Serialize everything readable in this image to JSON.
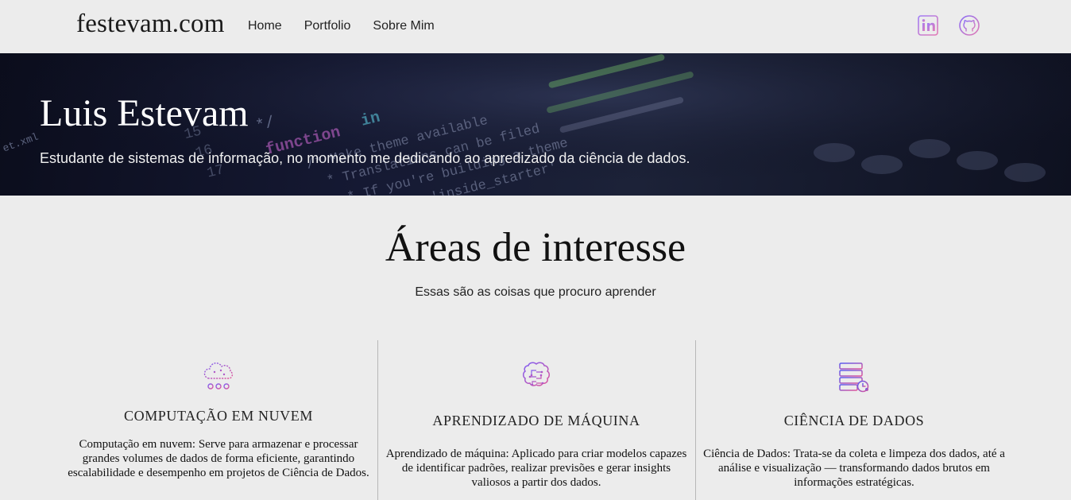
{
  "nav": {
    "brand": "festevam.com",
    "links": [
      "Home",
      "Portfolio",
      "Sobre Mim"
    ],
    "social": [
      {
        "icon": "linkedin-icon"
      },
      {
        "icon": "github-icon"
      }
    ]
  },
  "hero": {
    "name": "Luis Estevam",
    "subtitle": "Estudante de sistemas de informação, no momento me dedicando ao apredizado da ciência de dados."
  },
  "section": {
    "title": "Áreas de interesse",
    "subtitle": "Essas são as coisas que procuro aprender"
  },
  "cards": [
    {
      "icon": "cloud-computing-icon",
      "title": "COMPUTAÇÃO EM NUVEM",
      "text": "Computação em nuvem: Serve para armazenar e processar grandes volumes de dados de forma eficiente, garantindo escalabilidade e desempenho em projetos de Ciência de Dados."
    },
    {
      "icon": "brain-chip-icon",
      "title": "APRENDIZADO DE MÁQUINA",
      "text": "Aprendizado de máquina: Aplicado para criar modelos capazes de identificar padrões, realizar previsões e gerar insights valiosos a partir dos dados."
    },
    {
      "icon": "database-server-icon",
      "title": "CIÊNCIA DE DADOS",
      "text": "Ciência de Dados: Trata-se da coleta e limpeza dos dados, até a análise e visualização — transformando dados brutos em informações estratégicas."
    }
  ],
  "colors": {
    "icon_gradient_start": "#7b5cf5",
    "icon_gradient_end": "#e0559a",
    "hero_dark": "#0b0d1c"
  }
}
